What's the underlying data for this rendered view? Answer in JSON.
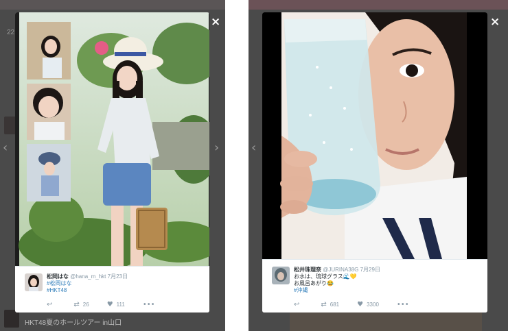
{
  "left": {
    "background": {
      "tab_count": "22",
      "bottom_name": "",
      "bottom_text": "HKT48夏のホールツアー in山口"
    },
    "close_icon": "×",
    "prev_icon": "‹",
    "next_icon": "›",
    "tweet": {
      "name": "松岡はな",
      "handle": "@hana_m_hkt",
      "date": "7月23日",
      "lines": [
        "#松岡はな",
        "#HKT48"
      ],
      "retweets": "26",
      "likes": "111"
    }
  },
  "right": {
    "close_icon": "×",
    "prev_icon": "‹",
    "tweet": {
      "name": "松井珠理奈",
      "handle": "@JURINA38G",
      "date": "7月29日",
      "lines": [
        "お水は、琉球グラス🌊💛",
        "お風呂あがり😂",
        "#沖縄"
      ],
      "retweets": "681",
      "likes": "3300"
    }
  },
  "icons": {
    "reply": "reply-icon",
    "retweet": "retweet-icon",
    "like": "heart-icon",
    "more": "more-icon"
  },
  "colors": {
    "overlay": "#4a4a4a",
    "link": "#2b7bb9",
    "muted": "#8899a6"
  }
}
